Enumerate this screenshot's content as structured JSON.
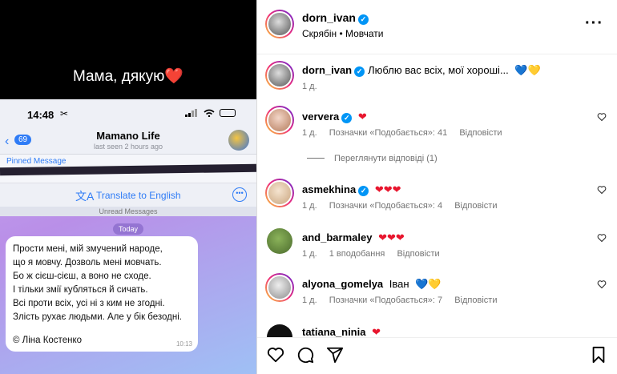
{
  "story": {
    "caption": "Мама, дякую",
    "caption_heart": "❤️",
    "phone": {
      "time": "14:48",
      "scissors": "✂",
      "back_count": "69",
      "chat_title": "Mamano Life",
      "last_seen": "last seen 2 hours ago",
      "pinned_label": "Pinned Message",
      "translate_label": "Translate to English",
      "unread_label": "Unread Messages",
      "today_label": "Today",
      "poem": [
        "Прости мені, мій змучений народе,",
        "що я мовчу. Дозволь мені мовчать.",
        "Бо ж сієш-сієш, а воно не сходе.",
        "І тільки змії кубляться й сичать.",
        "Всі проти всіх, усі ні з ким не згодні.",
        "Злість рухає людьми. Але у бік безодні."
      ],
      "author": "© Ліна Костенко",
      "message_time": "10:13"
    }
  },
  "post": {
    "owner": "dorn_ivan",
    "track": "Скрябін • Мовчати",
    "caption_text": "Люблю вас всіх, мої хороші...",
    "caption_flags": "💙💛",
    "caption_time": "1 д."
  },
  "comments": [
    {
      "user": "ververa",
      "text": "",
      "hearts": "❤",
      "time": "1 д.",
      "likes": "Позначки «Подобається»: 41",
      "reply": "Відповісти"
    },
    {
      "user": "asmekhina",
      "text": "",
      "hearts": "❤❤❤",
      "time": "1 д.",
      "likes": "Позначки «Подобається»: 4",
      "reply": "Відповісти"
    },
    {
      "user": "and_barmaley",
      "text": "",
      "hearts": "❤❤❤",
      "time": "1 д.",
      "likes": "1 вподобання",
      "reply": "Відповісти"
    },
    {
      "user": "alyona_gomelya",
      "text": "Іван",
      "hearts": "💙💛",
      "time": "1 д.",
      "likes": "Позначки «Подобається»: 7",
      "reply": "Відповісти"
    },
    {
      "user": "tatiana_ninia",
      "text": "",
      "hearts": "❤",
      "time": "",
      "likes": "",
      "reply": ""
    }
  ],
  "view_replies": "Переглянути відповіді (1)",
  "verified_mark": "✓",
  "more_menu": "···",
  "icons": [
    "heart-outline-icon",
    "comment-icon",
    "share-icon",
    "bookmark-icon",
    "verified-icon",
    "more-icon"
  ],
  "colors": {
    "verified": "#0095f6",
    "heart": "#e8162e",
    "telegram_blue": "#2f7cf6"
  }
}
